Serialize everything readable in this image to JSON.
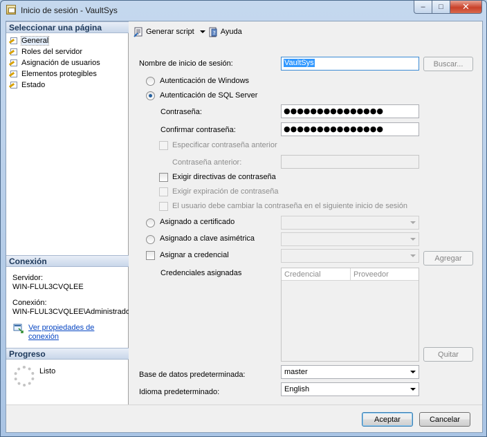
{
  "window": {
    "title": "Inicio de sesión - VaultSys",
    "minimize": "–",
    "maximize": "□",
    "close": "✕"
  },
  "left": {
    "select_page_header": "Seleccionar una página",
    "pages": [
      {
        "label": "General",
        "selected": true
      },
      {
        "label": "Roles del servidor",
        "selected": false
      },
      {
        "label": "Asignación de usuarios",
        "selected": false
      },
      {
        "label": "Elementos protegibles",
        "selected": false
      },
      {
        "label": "Estado",
        "selected": false
      }
    ],
    "connection_header": "Conexión",
    "server_label": "Servidor:",
    "server_value": "WIN-FLUL3CVQLEE",
    "connection_label": "Conexión:",
    "connection_value": "WIN-FLUL3CVQLEE\\Administrado",
    "view_props_line1": "Ver propiedades de",
    "view_props_line2": "conexión",
    "progress_header": "Progreso",
    "progress_status": "Listo"
  },
  "toolbar": {
    "script_label": "Generar script",
    "help_label": "Ayuda"
  },
  "form": {
    "login_name_label": "Nombre de inicio de sesión:",
    "login_name_value": "VaultSys",
    "search_button": "Buscar...",
    "windows_auth": "Autenticación de Windows",
    "sql_auth": "Autenticación de SQL Server",
    "password_label": "Contraseña:",
    "password_value": "●●●●●●●●●●●●●●●",
    "confirm_label": "Confirmar contraseña:",
    "confirm_value": "●●●●●●●●●●●●●●●",
    "specify_old": "Especificar contraseña anterior",
    "old_password_label": "Contraseña anterior:",
    "enforce_policy": "Exigir directivas de contraseña",
    "enforce_expiration": "Exigir expiración de contraseña",
    "must_change": "El usuario debe cambiar la contraseña en el siguiente inicio de sesión",
    "mapped_cert": "Asignado a certificado",
    "mapped_asym": "Asignado a clave asimétrica",
    "map_credential": "Asignar a credencial",
    "add_button": "Agregar",
    "mapped_credentials": "Credenciales asignadas",
    "col_credential": "Credencial",
    "col_provider": "Proveedor",
    "remove_button": "Quitar",
    "default_db_label": "Base de datos predeterminada:",
    "default_db_value": "master",
    "default_lang_label": "Idioma predeterminado:",
    "default_lang_value": "English"
  },
  "footer": {
    "ok_button": "Aceptar",
    "cancel_button": "Cancelar"
  }
}
